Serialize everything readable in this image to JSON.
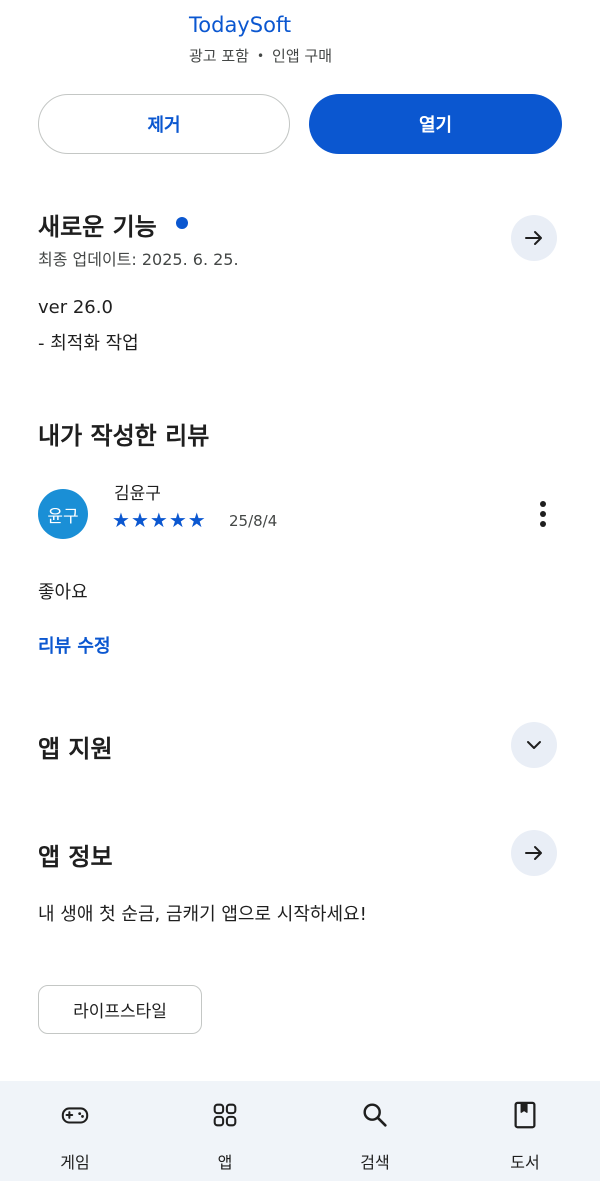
{
  "header": {
    "developer": "TodaySoft",
    "ads_label": "광고 포함",
    "separator": "•",
    "iap_label": "인앱 구매"
  },
  "actions": {
    "uninstall_label": "제거",
    "open_label": "열기"
  },
  "whats_new": {
    "title": "새로운 기능",
    "updated": "최종 업데이트: 2025. 6. 25.",
    "version_line": "ver 26.0",
    "note_line": "- 최적화 작업"
  },
  "my_review": {
    "title": "내가 작성한 리뷰",
    "avatar_text": "윤구",
    "reviewer_name": "김윤구",
    "rating": 5,
    "star_glyph": "★",
    "date": "25/8/4",
    "text": "좋아요",
    "edit_label": "리뷰 수정"
  },
  "app_support": {
    "title": "앱 지원"
  },
  "app_info": {
    "title": "앱 정보",
    "description": "내 생애 첫 순금, 금캐기 앱으로 시작하세요!",
    "category": "라이프스타일"
  },
  "bottom_nav": {
    "items": [
      {
        "label": "게임",
        "icon": "gamepad-icon"
      },
      {
        "label": "앱",
        "icon": "apps-grid-icon"
      },
      {
        "label": "검색",
        "icon": "search-icon"
      },
      {
        "label": "도서",
        "icon": "book-icon"
      }
    ]
  },
  "colors": {
    "accent": "#0b57d0",
    "text": "#1f1f1f",
    "secondary_text": "#444746",
    "round_button_bg": "#e9eef6",
    "nav_bg": "#f0f4f9",
    "avatar_bg": "#1a8fd6"
  }
}
